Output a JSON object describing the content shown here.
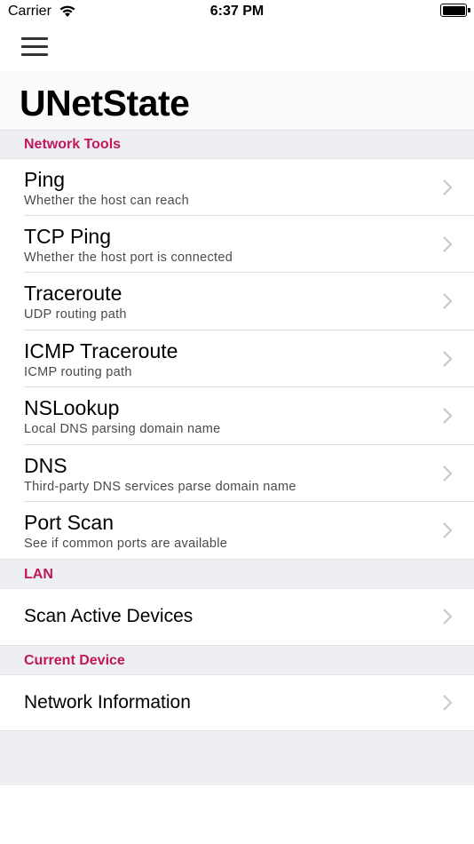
{
  "status_bar": {
    "carrier": "Carrier",
    "time": "6:37 PM"
  },
  "header": {
    "title": "UNetState",
    "menu_icon": "hamburger-menu-icon"
  },
  "sections": [
    {
      "title": "Network Tools",
      "rows": [
        {
          "title": "Ping",
          "subtitle": "Whether the host can reach"
        },
        {
          "title": "TCP Ping",
          "subtitle": "Whether the host port is connected"
        },
        {
          "title": "Traceroute",
          "subtitle": "UDP routing path"
        },
        {
          "title": "ICMP Traceroute",
          "subtitle": "ICMP routing path"
        },
        {
          "title": "NSLookup",
          "subtitle": "Local DNS parsing domain name"
        },
        {
          "title": "DNS",
          "subtitle": "Third-party DNS services parse domain name"
        },
        {
          "title": "Port Scan",
          "subtitle": "See if common ports are available"
        }
      ]
    },
    {
      "title": "LAN",
      "rows": [
        {
          "title": "Scan Active Devices"
        }
      ]
    },
    {
      "title": "Current Device",
      "rows": [
        {
          "title": "Network Information"
        }
      ]
    }
  ],
  "colors": {
    "section_header_text": "#c0175d",
    "section_bg": "#eeeff2",
    "chevron": "#c7c7cc"
  }
}
